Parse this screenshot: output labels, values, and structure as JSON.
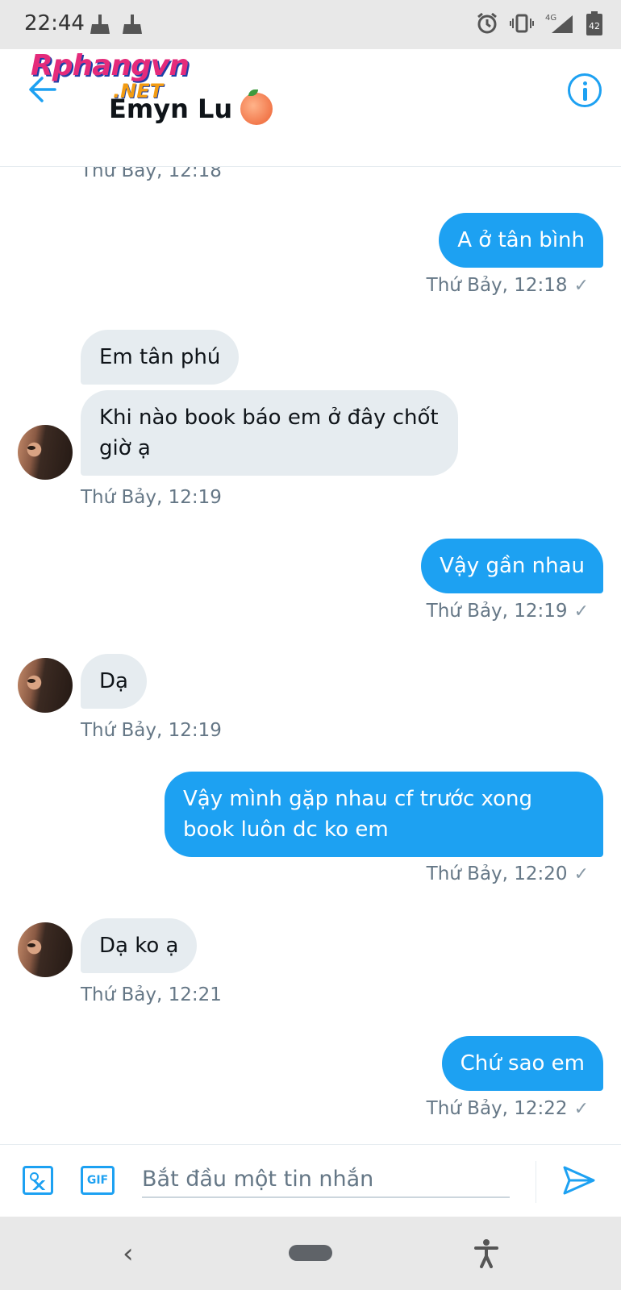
{
  "status_bar": {
    "time": "22:44",
    "left_icons": [
      "broom-icon",
      "broom-icon"
    ],
    "right_icons": [
      "alarm-icon",
      "vibrate-icon",
      "signal-4g-icon",
      "battery-icon"
    ],
    "network": "4G",
    "battery": "42"
  },
  "header": {
    "back_icon": "arrow-left-icon",
    "logo_main": "Rphangvn",
    "logo_sub": ".NET",
    "contact_name": "Emyn Lu",
    "contact_emoji": "peach-icon",
    "info_icon": "info-icon"
  },
  "messages": [
    {
      "id": "m0",
      "timestamp": "Thứ Bảy, 12:18",
      "side": "in"
    },
    {
      "id": "m1",
      "text": "A ở tân bình",
      "timestamp": "Thứ Bảy, 12:18",
      "side": "out",
      "status": "✓"
    },
    {
      "id": "m2",
      "text": "Em tân phú",
      "side": "in"
    },
    {
      "id": "m3",
      "text": "Khi nào book báo em ở đây chốt giờ ạ",
      "timestamp": "Thứ Bảy, 12:19",
      "side": "in"
    },
    {
      "id": "m4",
      "text": "Vậy gần nhau",
      "timestamp": "Thứ Bảy, 12:19",
      "side": "out",
      "status": "✓"
    },
    {
      "id": "m5",
      "text": "Dạ",
      "timestamp": "Thứ Bảy, 12:19",
      "side": "in"
    },
    {
      "id": "m6",
      "text": "Vậy mình gặp nhau cf trước xong book luôn dc ko em",
      "timestamp": "Thứ Bảy, 12:20",
      "side": "out",
      "status": "✓"
    },
    {
      "id": "m7",
      "text": "Dạ ko ạ",
      "timestamp": "Thứ Bảy, 12:21",
      "side": "in"
    },
    {
      "id": "m8",
      "text": "Chứ sao em",
      "timestamp": "Thứ Bảy, 12:22",
      "side": "out",
      "status": "✓"
    }
  ],
  "composer": {
    "media_icon": "image-icon",
    "gif_label": "GIF",
    "placeholder": "Bắt đầu một tin nhắn",
    "send_icon": "send-icon"
  },
  "nav_bar": {
    "back_glyph": "‹",
    "home_icon": "home-pill-icon",
    "accessibility_icon": "accessibility-icon"
  },
  "colors": {
    "accent": "#1da1f2",
    "incoming_bubble": "#e6ecf0",
    "timestamp": "#657786",
    "system_bar": "#e8e8e8"
  }
}
